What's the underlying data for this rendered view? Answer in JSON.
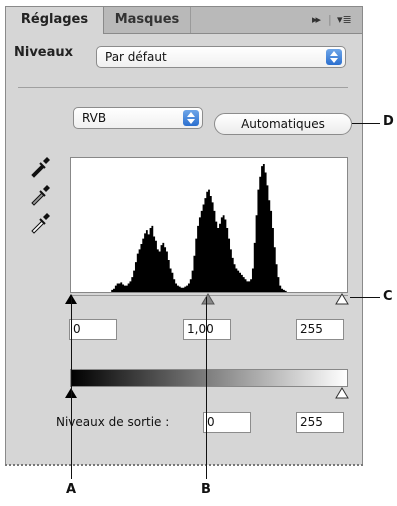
{
  "tabs": [
    {
      "label": "Réglages",
      "active": true
    },
    {
      "label": "Masques",
      "active": false
    }
  ],
  "tab_controls": {
    "expand": "▸▸",
    "menu": "▾≣"
  },
  "preset": {
    "label": "Niveaux",
    "value": "Par défaut"
  },
  "channel": {
    "value": "RVB"
  },
  "auto_button": {
    "label": "Automatiques"
  },
  "input_levels": {
    "shadows": "0",
    "midtones": "1,00",
    "highlights": "255"
  },
  "output_levels": {
    "label": "Niveaux de sortie :",
    "shadows": "0",
    "highlights": "255"
  },
  "histogram": {
    "bins": [
      0,
      0,
      0,
      0,
      0,
      0,
      0,
      0,
      0,
      0,
      0,
      0,
      0,
      0,
      0,
      0,
      0,
      0,
      0,
      0,
      0,
      0,
      2,
      3,
      6,
      8,
      8,
      9,
      7,
      6,
      6,
      8,
      10,
      14,
      20,
      28,
      36,
      40,
      45,
      50,
      55,
      58,
      54,
      60,
      62,
      52,
      48,
      40,
      38,
      44,
      46,
      42,
      38,
      30,
      22,
      18,
      12,
      8,
      6,
      5,
      4,
      4,
      5,
      6,
      8,
      12,
      20,
      34,
      50,
      62,
      70,
      76,
      82,
      88,
      94,
      96,
      90,
      84,
      76,
      66,
      60,
      64,
      70,
      72,
      68,
      60,
      50,
      40,
      32,
      26,
      22,
      20,
      18,
      16,
      14,
      12,
      10,
      10,
      12,
      22,
      46,
      72,
      96,
      108,
      118,
      120,
      112,
      100,
      86,
      76,
      60,
      42,
      26,
      14,
      6,
      3,
      2,
      1,
      0,
      0,
      0,
      0,
      0,
      0,
      0,
      0,
      0,
      0,
      0,
      0,
      0,
      0,
      0,
      0,
      0,
      0,
      0,
      0,
      0,
      0,
      0,
      0,
      0,
      0,
      0,
      0,
      0,
      0,
      0,
      0,
      0
    ]
  },
  "callouts": [
    "A",
    "B",
    "C",
    "D"
  ]
}
